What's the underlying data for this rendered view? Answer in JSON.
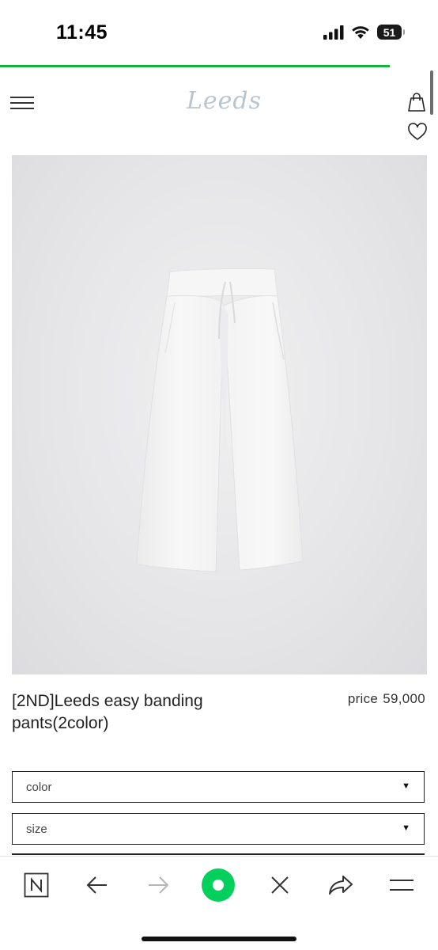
{
  "status_bar": {
    "time": "11:45",
    "battery_level": "51",
    "icons": [
      "signal-icon",
      "wifi-icon",
      "battery-icon"
    ]
  },
  "page_load_progress": 0.89,
  "site": {
    "logo_text": "Leeds",
    "icons": [
      "menu-icon",
      "shopping-bag-icon",
      "heart-icon"
    ]
  },
  "product": {
    "name": "[2ND]Leeds easy banding pants(2color)",
    "price_label": "price",
    "price_value": "59,000",
    "image_subject": "white-wide-banding-pants"
  },
  "options": [
    {
      "label": "color",
      "arrow": "▼"
    },
    {
      "label": "size",
      "arrow": "▼"
    }
  ],
  "browser_bar": {
    "icons": [
      "naver-n-icon",
      "back-arrow-icon",
      "forward-arrow-icon",
      "green-home-icon",
      "close-icon",
      "share-icon",
      "hamburger-menu-icon"
    ]
  },
  "colors": {
    "progress": "#12b33c",
    "brand_green": "#03cf5d",
    "logo": "#b8c4cf"
  }
}
